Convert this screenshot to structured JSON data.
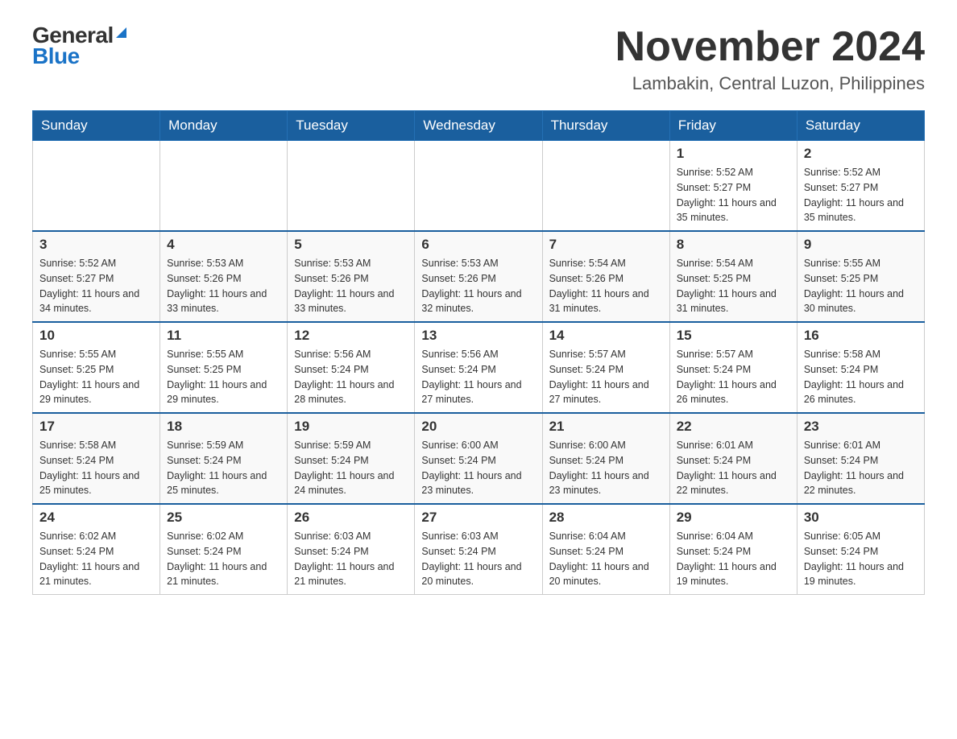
{
  "header": {
    "logo_general": "General",
    "logo_blue": "Blue",
    "month_year": "November 2024",
    "location": "Lambakin, Central Luzon, Philippines"
  },
  "weekdays": [
    "Sunday",
    "Monday",
    "Tuesday",
    "Wednesday",
    "Thursday",
    "Friday",
    "Saturday"
  ],
  "weeks": [
    [
      {
        "day": "",
        "info": ""
      },
      {
        "day": "",
        "info": ""
      },
      {
        "day": "",
        "info": ""
      },
      {
        "day": "",
        "info": ""
      },
      {
        "day": "",
        "info": ""
      },
      {
        "day": "1",
        "info": "Sunrise: 5:52 AM\nSunset: 5:27 PM\nDaylight: 11 hours and 35 minutes."
      },
      {
        "day": "2",
        "info": "Sunrise: 5:52 AM\nSunset: 5:27 PM\nDaylight: 11 hours and 35 minutes."
      }
    ],
    [
      {
        "day": "3",
        "info": "Sunrise: 5:52 AM\nSunset: 5:27 PM\nDaylight: 11 hours and 34 minutes."
      },
      {
        "day": "4",
        "info": "Sunrise: 5:53 AM\nSunset: 5:26 PM\nDaylight: 11 hours and 33 minutes."
      },
      {
        "day": "5",
        "info": "Sunrise: 5:53 AM\nSunset: 5:26 PM\nDaylight: 11 hours and 33 minutes."
      },
      {
        "day": "6",
        "info": "Sunrise: 5:53 AM\nSunset: 5:26 PM\nDaylight: 11 hours and 32 minutes."
      },
      {
        "day": "7",
        "info": "Sunrise: 5:54 AM\nSunset: 5:26 PM\nDaylight: 11 hours and 31 minutes."
      },
      {
        "day": "8",
        "info": "Sunrise: 5:54 AM\nSunset: 5:25 PM\nDaylight: 11 hours and 31 minutes."
      },
      {
        "day": "9",
        "info": "Sunrise: 5:55 AM\nSunset: 5:25 PM\nDaylight: 11 hours and 30 minutes."
      }
    ],
    [
      {
        "day": "10",
        "info": "Sunrise: 5:55 AM\nSunset: 5:25 PM\nDaylight: 11 hours and 29 minutes."
      },
      {
        "day": "11",
        "info": "Sunrise: 5:55 AM\nSunset: 5:25 PM\nDaylight: 11 hours and 29 minutes."
      },
      {
        "day": "12",
        "info": "Sunrise: 5:56 AM\nSunset: 5:24 PM\nDaylight: 11 hours and 28 minutes."
      },
      {
        "day": "13",
        "info": "Sunrise: 5:56 AM\nSunset: 5:24 PM\nDaylight: 11 hours and 27 minutes."
      },
      {
        "day": "14",
        "info": "Sunrise: 5:57 AM\nSunset: 5:24 PM\nDaylight: 11 hours and 27 minutes."
      },
      {
        "day": "15",
        "info": "Sunrise: 5:57 AM\nSunset: 5:24 PM\nDaylight: 11 hours and 26 minutes."
      },
      {
        "day": "16",
        "info": "Sunrise: 5:58 AM\nSunset: 5:24 PM\nDaylight: 11 hours and 26 minutes."
      }
    ],
    [
      {
        "day": "17",
        "info": "Sunrise: 5:58 AM\nSunset: 5:24 PM\nDaylight: 11 hours and 25 minutes."
      },
      {
        "day": "18",
        "info": "Sunrise: 5:59 AM\nSunset: 5:24 PM\nDaylight: 11 hours and 25 minutes."
      },
      {
        "day": "19",
        "info": "Sunrise: 5:59 AM\nSunset: 5:24 PM\nDaylight: 11 hours and 24 minutes."
      },
      {
        "day": "20",
        "info": "Sunrise: 6:00 AM\nSunset: 5:24 PM\nDaylight: 11 hours and 23 minutes."
      },
      {
        "day": "21",
        "info": "Sunrise: 6:00 AM\nSunset: 5:24 PM\nDaylight: 11 hours and 23 minutes."
      },
      {
        "day": "22",
        "info": "Sunrise: 6:01 AM\nSunset: 5:24 PM\nDaylight: 11 hours and 22 minutes."
      },
      {
        "day": "23",
        "info": "Sunrise: 6:01 AM\nSunset: 5:24 PM\nDaylight: 11 hours and 22 minutes."
      }
    ],
    [
      {
        "day": "24",
        "info": "Sunrise: 6:02 AM\nSunset: 5:24 PM\nDaylight: 11 hours and 21 minutes."
      },
      {
        "day": "25",
        "info": "Sunrise: 6:02 AM\nSunset: 5:24 PM\nDaylight: 11 hours and 21 minutes."
      },
      {
        "day": "26",
        "info": "Sunrise: 6:03 AM\nSunset: 5:24 PM\nDaylight: 11 hours and 21 minutes."
      },
      {
        "day": "27",
        "info": "Sunrise: 6:03 AM\nSunset: 5:24 PM\nDaylight: 11 hours and 20 minutes."
      },
      {
        "day": "28",
        "info": "Sunrise: 6:04 AM\nSunset: 5:24 PM\nDaylight: 11 hours and 20 minutes."
      },
      {
        "day": "29",
        "info": "Sunrise: 6:04 AM\nSunset: 5:24 PM\nDaylight: 11 hours and 19 minutes."
      },
      {
        "day": "30",
        "info": "Sunrise: 6:05 AM\nSunset: 5:24 PM\nDaylight: 11 hours and 19 minutes."
      }
    ]
  ]
}
